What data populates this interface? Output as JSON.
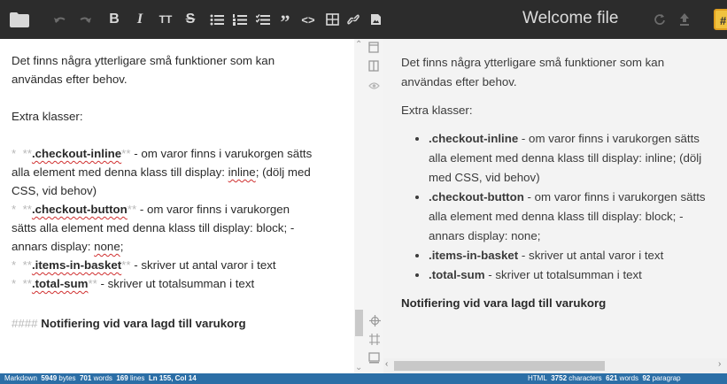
{
  "toolbar": {
    "title": "Welcome file",
    "icons": [
      "folder-icon",
      "undo-icon",
      "redo-icon",
      "bold-icon",
      "italic-icon",
      "heading-icon",
      "strikethrough-icon",
      "unordered-list-icon",
      "ordered-list-icon",
      "checklist-icon",
      "quote-icon",
      "code-icon",
      "table-icon",
      "link-icon",
      "image-icon",
      "sync-icon",
      "publish-icon",
      "workspace-icon"
    ],
    "bold": "B",
    "italic": "I",
    "heading": "TT",
    "strike": "S",
    "quote": "”",
    "code": "<>",
    "hash": "#"
  },
  "editor": {
    "line1": "Det finns några ytterligare små funktioner som kan",
    "line2": "användas efter behov.",
    "extra": "Extra klasser:",
    "items": [
      {
        "bullet": "*",
        "open": "**",
        "name": ".checkout-inline",
        "close": "**",
        "text1": " - om varor finns i varukorgen sätts",
        "text2": "alla element med denna klass till display: ",
        "w1": "inline",
        "text3": "; (dölj med",
        "text4": "CSS, vid behov)"
      },
      {
        "bullet": "*",
        "open": "**",
        "name": ".checkout-button",
        "close": "**",
        "text1": " - om varor finns i varukorgen",
        "text2": "sätts alla element med denna klass till display: block; -",
        "text3": "annars display: ",
        "w1": "none",
        "text4": ";"
      },
      {
        "bullet": "*",
        "open": "**",
        "name": ".items-in-basket",
        "close": "**",
        "text1": " - skriver ut antal varor i text"
      },
      {
        "bullet": "*",
        "open": "**",
        "name": ".total-sum",
        "close": "**",
        "text1": " - skriver ut totalsumman i text"
      }
    ],
    "heading_marks": "####",
    "heading": "Notifiering vid vara lagd till varukorg"
  },
  "preview": {
    "line1": "Det finns några ytterligare små funktioner som kan",
    "line2": "användas efter behov.",
    "extra": "Extra klasser:",
    "items": [
      {
        "name": ".checkout-inline",
        "text": " - om varor finns i varukorgen sätts alla element med denna klass till display: inline; (dölj med CSS, vid behov)"
      },
      {
        "name": ".checkout-button",
        "text": " - om varor finns i varukorgen sätts alla element med denna klass till display: block; - annars display: none;"
      },
      {
        "name": ".items-in-basket",
        "text": " - skriver ut antal varor i text"
      },
      {
        "name": ".total-sum",
        "text": " - skriver ut totalsumman i text"
      }
    ],
    "heading": "Notifiering vid vara lagd till varukorg"
  },
  "status": {
    "left_label": "Markdown",
    "bytes": "5949",
    "bytes_label": "bytes",
    "words": "701",
    "words_label": "words",
    "lines": "169",
    "lines_label": "lines",
    "pos": "Ln 155, Col 14",
    "right_label": "HTML",
    "chars": "3752",
    "chars_label": "characters",
    "pwords": "621",
    "pwords_label": "words",
    "paras": "92",
    "paras_label": "paragrap"
  },
  "colors": {
    "toolbar": "#2c2c2c",
    "status": "#2b6ea6",
    "accent": "#f0c23e",
    "spell": "#d03030"
  }
}
